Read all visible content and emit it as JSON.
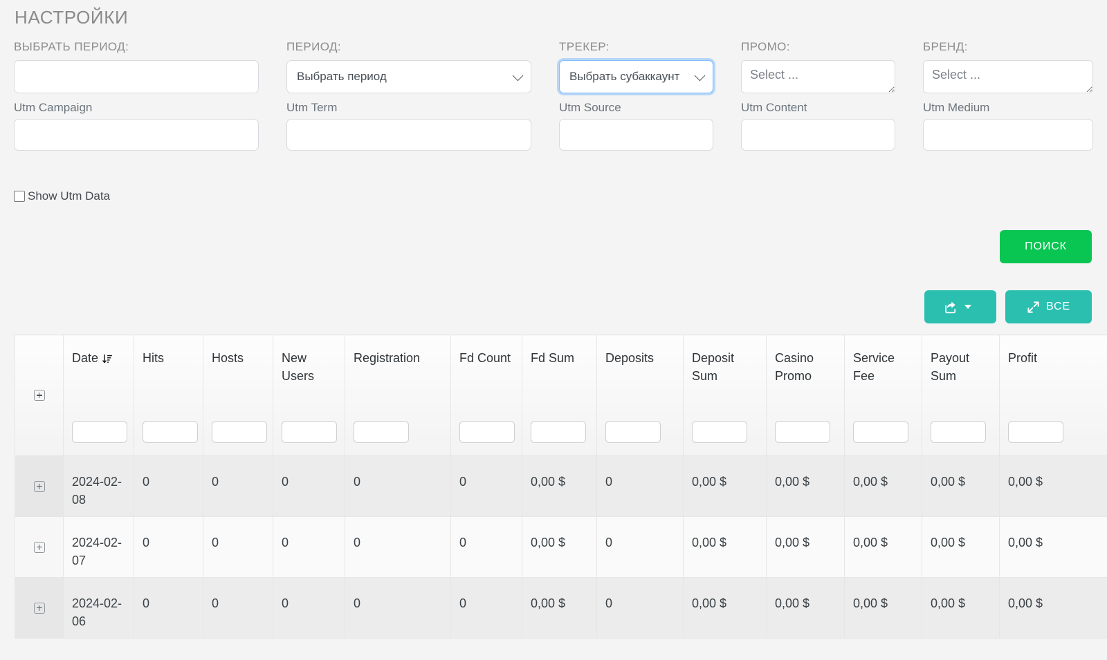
{
  "settings": {
    "title": "НАСТРОЙКИ"
  },
  "filters": {
    "row1": [
      {
        "label": "ВЫБРАТЬ ПЕРИОД:",
        "type": "text",
        "value": "",
        "placeholder": ""
      },
      {
        "label": "ПЕРИОД:",
        "type": "select",
        "value": "Выбрать период"
      },
      {
        "label": "ТРЕКЕР:",
        "type": "select",
        "value": "Выбрать субаккаунт",
        "focused": true
      },
      {
        "label": "ПРОМО:",
        "type": "multiselect",
        "value": "Select ..."
      },
      {
        "label": "БРЕНД:",
        "type": "multiselect",
        "value": "Select ..."
      }
    ],
    "row2": [
      {
        "label": "Utm Campaign",
        "value": ""
      },
      {
        "label": "Utm Term",
        "value": ""
      },
      {
        "label": "Utm Source",
        "value": ""
      },
      {
        "label": "Utm Content",
        "value": ""
      },
      {
        "label": "Utm Medium",
        "value": ""
      }
    ],
    "show_utm_data": {
      "label": "Show Utm Data",
      "checked": false
    }
  },
  "actions": {
    "search_label": "ПОИСК",
    "export_label": "",
    "all_label": "ВСЕ"
  },
  "colors": {
    "search_green": "#09c551",
    "teal": "#2bbfb0",
    "focus_blue": "#80bdff",
    "page_bg": "#f4f4f4",
    "row_even": "#ececec",
    "row_odd": "#fafafa"
  },
  "table": {
    "columns": [
      {
        "label": "",
        "key": "expand"
      },
      {
        "label": "Date",
        "key": "date",
        "sorted": "desc"
      },
      {
        "label": "Hits",
        "key": "hits"
      },
      {
        "label": "Hosts",
        "key": "hosts"
      },
      {
        "label": "New Users",
        "key": "new_users"
      },
      {
        "label": "Registration",
        "key": "registration"
      },
      {
        "label": "Fd Count",
        "key": "fd_count"
      },
      {
        "label": "Fd Sum",
        "key": "fd_sum"
      },
      {
        "label": "Deposits",
        "key": "deposits"
      },
      {
        "label": "Deposit Sum",
        "key": "deposit_sum"
      },
      {
        "label": "Casino Promo",
        "key": "casino_promo"
      },
      {
        "label": "Service Fee",
        "key": "service_fee"
      },
      {
        "label": "Payout Sum",
        "key": "payout_sum"
      },
      {
        "label": "Profit",
        "key": "profit"
      }
    ],
    "column_filters": [
      "",
      "",
      "",
      "",
      "",
      "",
      "",
      "",
      "",
      "",
      "",
      "",
      ""
    ],
    "rows": [
      {
        "date": "2024-02-08",
        "hits": "0",
        "hosts": "0",
        "new_users": "0",
        "registration": "0",
        "fd_count": "0",
        "fd_sum": "0,00 $",
        "deposits": "0",
        "deposit_sum": "0,00 $",
        "casino_promo": "0,00 $",
        "service_fee": "0,00 $",
        "payout_sum": "0,00 $",
        "profit": "0,00 $"
      },
      {
        "date": "2024-02-07",
        "hits": "0",
        "hosts": "0",
        "new_users": "0",
        "registration": "0",
        "fd_count": "0",
        "fd_sum": "0,00 $",
        "deposits": "0",
        "deposit_sum": "0,00 $",
        "casino_promo": "0,00 $",
        "service_fee": "0,00 $",
        "payout_sum": "0,00 $",
        "profit": "0,00 $"
      },
      {
        "date": "2024-02-06",
        "hits": "0",
        "hosts": "0",
        "new_users": "0",
        "registration": "0",
        "fd_count": "0",
        "fd_sum": "0,00 $",
        "deposits": "0",
        "deposit_sum": "0,00 $",
        "casino_promo": "0,00 $",
        "service_fee": "0,00 $",
        "payout_sum": "0,00 $",
        "profit": "0,00 $"
      }
    ]
  }
}
